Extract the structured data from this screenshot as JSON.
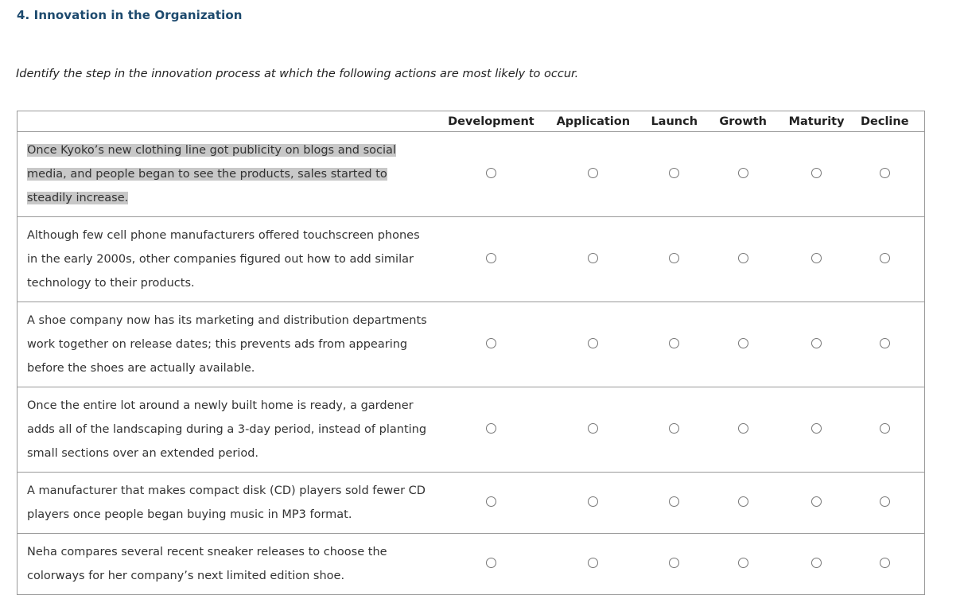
{
  "question": {
    "title": "4. Innovation in the Organization",
    "instructions": "Identify the step in the innovation process at which the following actions are most likely to occur."
  },
  "columns": [
    "Development",
    "Application",
    "Launch",
    "Growth",
    "Maturity",
    "Decline"
  ],
  "rows": [
    {
      "text": "Once Kyoko’s new clothing line got publicity on blogs and social media, and people began to see the products, sales started to steadily increase.",
      "highlighted": true,
      "selected": null
    },
    {
      "text": "Although few cell phone manufacturers offered touchscreen phones in the early 2000s, other companies figured out how to add similar technology to their products.",
      "highlighted": false,
      "selected": null
    },
    {
      "text": "A shoe company now has its marketing and distribution departments work together on release dates; this prevents ads from appearing before the shoes are actually available.",
      "highlighted": false,
      "selected": null
    },
    {
      "text": "Once the entire lot around a newly built home is ready, a gardener adds all of the landscaping during a 3-day period, instead of planting small sections over an extended period.",
      "highlighted": false,
      "selected": null
    },
    {
      "text": "A manufacturer that makes compact disk (CD) players sold fewer CD players once people began buying music in MP3 format.",
      "highlighted": false,
      "selected": null
    },
    {
      "text": "Neha compares several recent sneaker releases to choose the colorways for her company’s next limited edition shoe.",
      "highlighted": false,
      "selected": null
    }
  ]
}
